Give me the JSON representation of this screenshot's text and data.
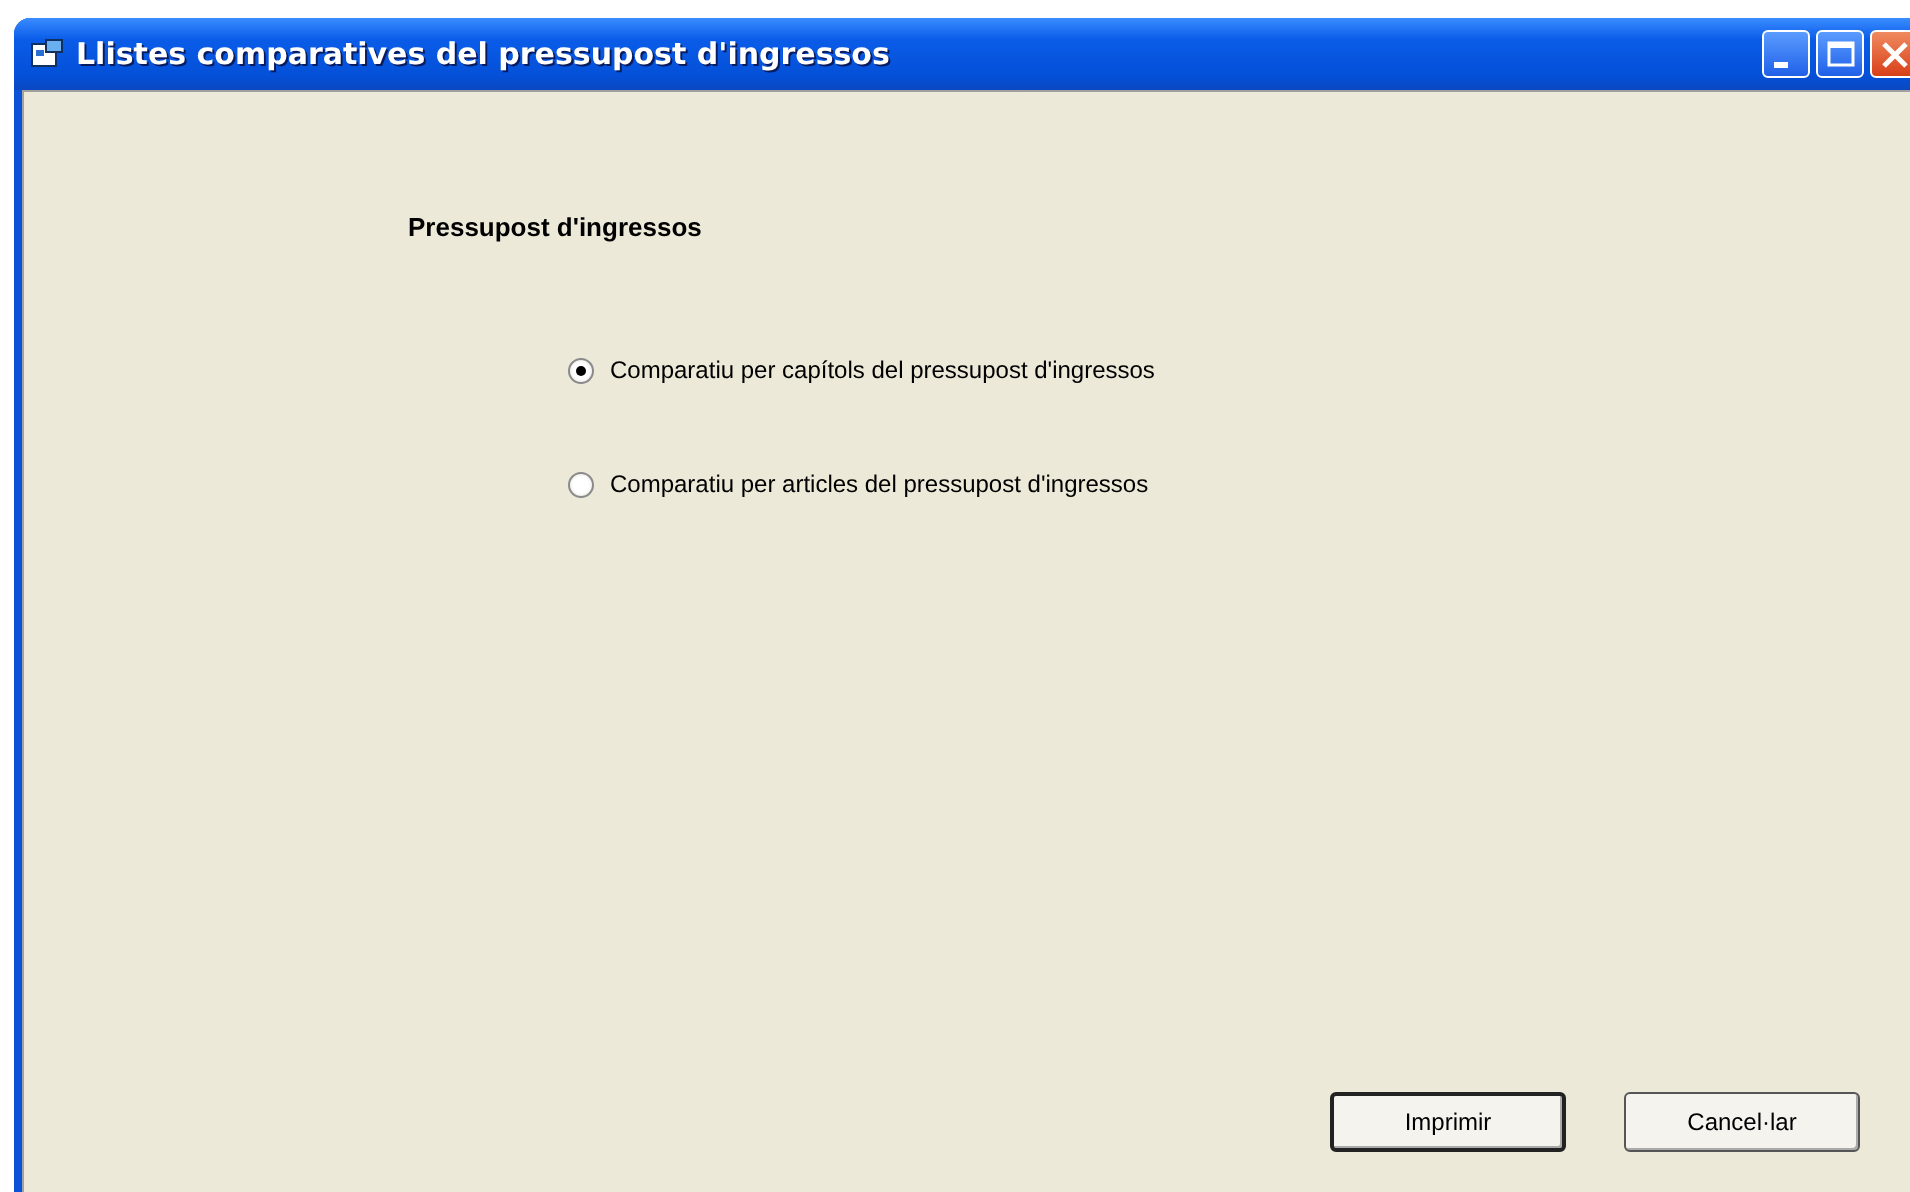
{
  "window": {
    "title": "Llistes comparatives del pressupost d'ingressos"
  },
  "heading": "Pressupost d'ingressos",
  "options": [
    {
      "label": "Comparatiu per capítols del pressupost d'ingressos",
      "selected": true
    },
    {
      "label": "Comparatiu per articles del pressupost d'ingressos",
      "selected": false
    }
  ],
  "buttons": [
    {
      "label": "Imprimir",
      "default": true
    },
    {
      "label": "Cancel·lar",
      "default": false
    }
  ]
}
